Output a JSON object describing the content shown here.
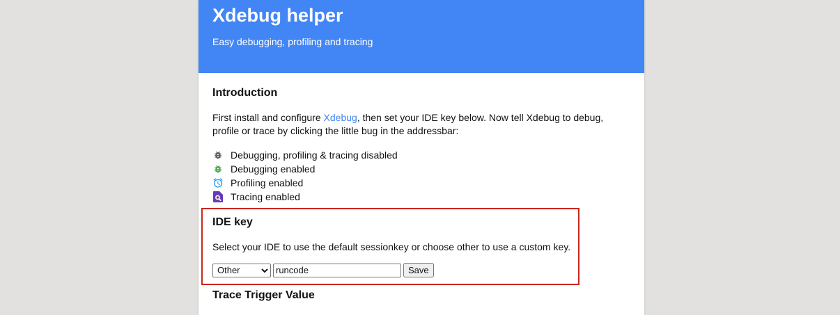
{
  "header": {
    "title": "Xdebug helper",
    "subtitle": "Easy debugging, profiling and tracing"
  },
  "intro": {
    "heading": "Introduction",
    "text_before": "First install and configure ",
    "link_text": "Xdebug",
    "text_after": ", then set your IDE key below. Now tell Xdebug to debug, profile or trace by clicking the little bug in the addressbar:",
    "legend": [
      {
        "icon": "bug-disabled-icon",
        "color": "#5f6368",
        "label": "Debugging, profiling & tracing disabled"
      },
      {
        "icon": "bug-enabled-icon",
        "color": "#4caf50",
        "label": "Debugging enabled"
      },
      {
        "icon": "clock-icon",
        "color": "#2196f3",
        "label": "Profiling enabled"
      },
      {
        "icon": "trace-file-icon",
        "color": "#673ab7",
        "label": "Tracing enabled"
      }
    ]
  },
  "ide_key": {
    "heading": "IDE key",
    "description": "Select your IDE to use the default sessionkey or choose other to use a custom key.",
    "selected_ide": "Other",
    "key_value": "runcode",
    "save_label": "Save"
  },
  "trace": {
    "heading": "Trace Trigger Value"
  },
  "colors": {
    "banner": "#4285f4",
    "highlight_border": "#c9271f",
    "background": "#e2e1df"
  }
}
